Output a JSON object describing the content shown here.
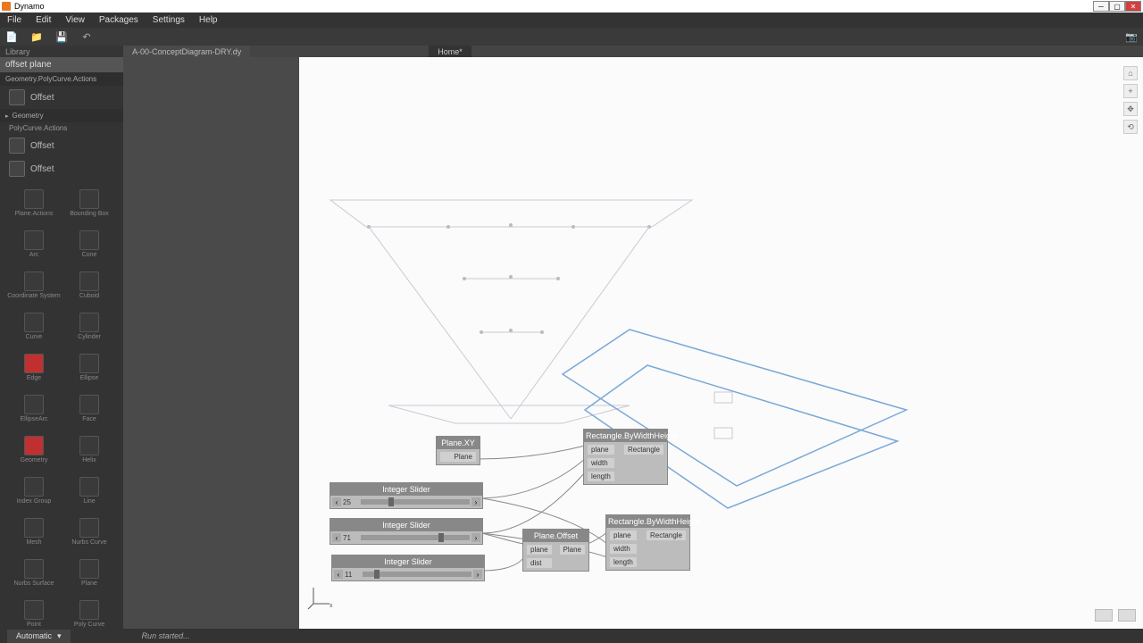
{
  "app": {
    "title": "Dynamo"
  },
  "menu": {
    "file": "File",
    "edit": "Edit",
    "view": "View",
    "packages": "Packages",
    "settings": "Settings",
    "help": "Help"
  },
  "tabs": {
    "library": "Library",
    "file1": "A-00-ConceptDiagram-DRY.dy",
    "file2": "Home*"
  },
  "library": {
    "search": "offset plane",
    "cat1": "Geometry.PolyCurve.Actions",
    "offset1": "Offset",
    "geometry": "Geometry",
    "polycurve": "PolyCurve.Actions",
    "offset2": "Offset",
    "offset3": "Offset",
    "cells": {
      "plane_actions": "Plane.Actions",
      "bounding": "Bounding Box",
      "arc": "Arc",
      "cone": "Cone",
      "coord": "Coordinate System",
      "cuboid": "Cuboid",
      "curve": "Curve",
      "cylinder": "Cylinder",
      "edge": "Edge",
      "ellipse": "Ellipse",
      "ellipse_arc": "EllipseArc",
      "face": "Face",
      "geometry2": "Geometry",
      "helix": "Helix",
      "index_group": "Index Group",
      "line": "Line",
      "mesh": "Mesh",
      "nurbs": "Nurbs Curve",
      "nurbs_surf": "Nurbs Surface",
      "plane": "Plane",
      "point": "Point",
      "poly": "Poly Curve"
    }
  },
  "nodes": {
    "plane_xy": {
      "title": "Plane.XY",
      "out": "Plane"
    },
    "rect1": {
      "title": "Rectangle.ByWidthHeight",
      "in1": "plane",
      "in2": "width",
      "in3": "length",
      "out": "Rectangle"
    },
    "rect2": {
      "title": "Rectangle.ByWidthHeight",
      "in1": "plane",
      "in2": "width",
      "in3": "length",
      "out": "Rectangle"
    },
    "plane_offset": {
      "title": "Plane.Offset",
      "in1": "plane",
      "in2": "dist",
      "out": "Plane"
    },
    "slider1": {
      "title": "Integer Slider",
      "value": "25"
    },
    "slider2": {
      "title": "Integer Slider",
      "value": "71"
    },
    "slider3": {
      "title": "Integer Slider",
      "value": "11"
    }
  },
  "status": {
    "mode": "Automatic",
    "msg": "Run started..."
  }
}
